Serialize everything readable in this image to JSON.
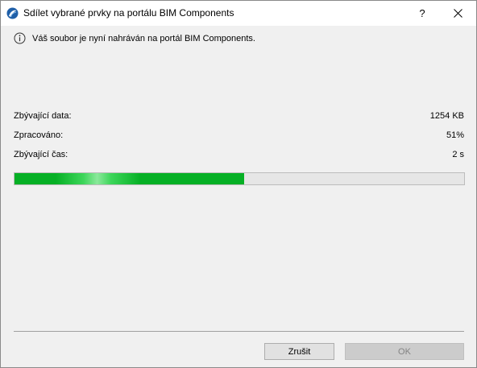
{
  "window": {
    "title": "Sdílet vybrané prvky na portálu BIM Components",
    "help_label": "?",
    "close_icon": "close-icon",
    "app_icon": "archicad-logo-icon"
  },
  "info": {
    "icon": "info-circle-icon",
    "message": "Váš soubor je nyní nahráván na portál BIM Components."
  },
  "stats": {
    "remaining_data_label": "Zbývající data:",
    "remaining_data_value": "1254 KB",
    "processed_label": "Zpracováno:",
    "processed_value": "51%",
    "remaining_time_label": "Zbývající čas:",
    "remaining_time_value": "2 s"
  },
  "progress": {
    "percent": 51,
    "color": "#06b025"
  },
  "buttons": {
    "cancel_label": "Zrušit",
    "ok_label": "OK",
    "ok_enabled": false
  }
}
